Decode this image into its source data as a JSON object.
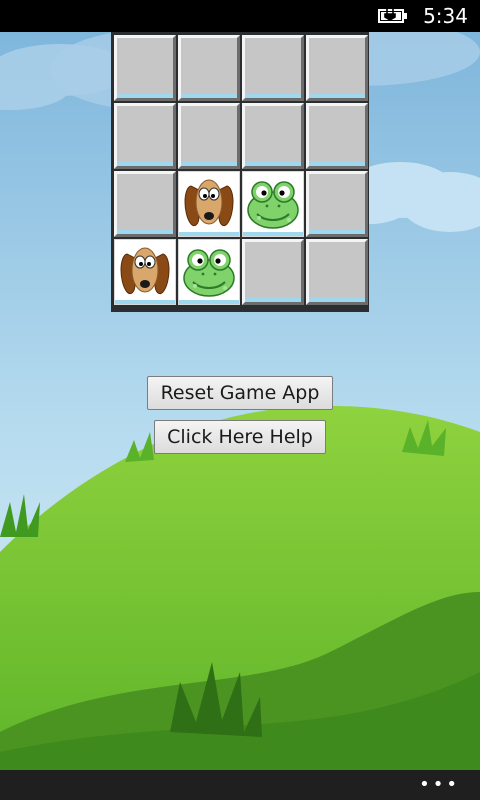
{
  "status_bar": {
    "time": "5:34",
    "battery_icon": "battery-charging-icon"
  },
  "board": {
    "rows": 4,
    "columns": 4,
    "tiles": [
      {
        "row": 1,
        "col": 1,
        "state": "hidden"
      },
      {
        "row": 1,
        "col": 2,
        "state": "hidden"
      },
      {
        "row": 1,
        "col": 3,
        "state": "hidden"
      },
      {
        "row": 1,
        "col": 4,
        "state": "hidden"
      },
      {
        "row": 2,
        "col": 1,
        "state": "hidden"
      },
      {
        "row": 2,
        "col": 2,
        "state": "hidden"
      },
      {
        "row": 2,
        "col": 3,
        "state": "hidden"
      },
      {
        "row": 2,
        "col": 4,
        "state": "hidden"
      },
      {
        "row": 3,
        "col": 1,
        "state": "hidden"
      },
      {
        "row": 3,
        "col": 2,
        "state": "revealed",
        "image": "dog-face-icon"
      },
      {
        "row": 3,
        "col": 3,
        "state": "revealed",
        "image": "frog-face-icon"
      },
      {
        "row": 3,
        "col": 4,
        "state": "hidden"
      },
      {
        "row": 4,
        "col": 1,
        "state": "revealed",
        "image": "dog-face-icon"
      },
      {
        "row": 4,
        "col": 2,
        "state": "revealed",
        "image": "frog-face-icon"
      },
      {
        "row": 4,
        "col": 3,
        "state": "hidden"
      },
      {
        "row": 4,
        "col": 4,
        "state": "hidden"
      }
    ]
  },
  "buttons": {
    "reset_label": "Reset Game App",
    "help_label": "Click Here Help"
  },
  "app_bar": {
    "more_label": "•••"
  },
  "colors": {
    "sky": "#9dc9e6",
    "hill_light": "#6fc22f",
    "hill_dark": "#3f8a1d",
    "tile_hidden": "#c6c6c6",
    "board_frame": "#2a2e30"
  }
}
